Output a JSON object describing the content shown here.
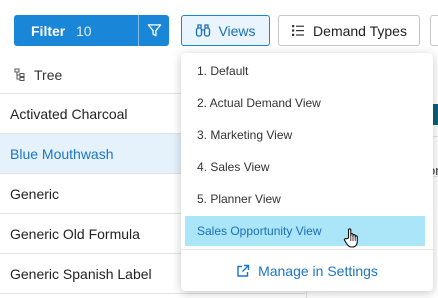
{
  "toolbar": {
    "filter_label": "Filter",
    "filter_count": "10",
    "filter_icon": "funnel-icon",
    "views_label": "Views",
    "views_icon": "binoculars-icon",
    "demand_types_label": "Demand Types",
    "demand_types_icon": "list-icon"
  },
  "tree": {
    "header": "Tree",
    "header_icon": "hierarchy-icon",
    "rows": [
      {
        "label": "Activated Charcoal"
      },
      {
        "label": "Blue Mouthwash",
        "selected": true
      },
      {
        "label": "Generic"
      },
      {
        "label": "Generic Old Formula"
      },
      {
        "label": "Generic Spanish Label"
      }
    ]
  },
  "right_column": {
    "partial_text": "or"
  },
  "views_menu": {
    "items": [
      {
        "label": "1. Default"
      },
      {
        "label": "2. Actual Demand View"
      },
      {
        "label": "3. Marketing View"
      },
      {
        "label": "4. Sales View"
      },
      {
        "label": "5. Planner View"
      },
      {
        "label": "Sales Opportunity View",
        "highlighted": true
      }
    ],
    "manage_label": "Manage in Settings",
    "manage_icon": "external-link-icon"
  },
  "colors": {
    "primary": "#1a86d8",
    "selected_row_bg": "#e5f2fb",
    "menu_highlight_bg": "#abe5f8",
    "link": "#1a75c8"
  }
}
